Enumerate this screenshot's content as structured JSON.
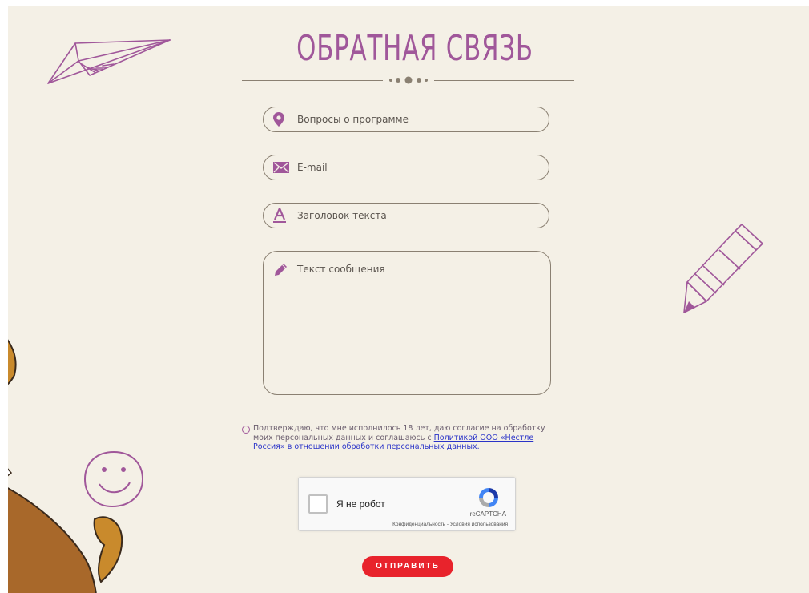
{
  "header": {
    "title": "ОБРАТНАЯ СВЯЗЬ"
  },
  "form": {
    "topic": {
      "value": "Вопросы о программе",
      "icon": "map-pin-icon"
    },
    "email": {
      "placeholder": "E-mail",
      "icon": "envelope-icon"
    },
    "subject": {
      "placeholder": "Заголовок текста",
      "icon": "text-a-icon"
    },
    "message": {
      "placeholder": "Текст сообщения",
      "icon": "pencil-icon"
    }
  },
  "consent": {
    "text": "Подтверждаю, что мне исполнилось 18 лет, даю согласие на обработку моих персональных данных и соглашаюсь с ",
    "link_text": "Политикой ООО «Нестле Россия» в отношении обработки персональных данных.",
    "checked": false
  },
  "captcha": {
    "label": "Я не робот",
    "brand": "reCAPTCHA",
    "links": "Конфиденциальность - Условия использования"
  },
  "submit": {
    "label": "ОТПРАВИТЬ"
  },
  "colors": {
    "accent": "#a0579a",
    "submit": "#e8232c",
    "background": "#f4f0e6",
    "border": "#8a8072"
  }
}
